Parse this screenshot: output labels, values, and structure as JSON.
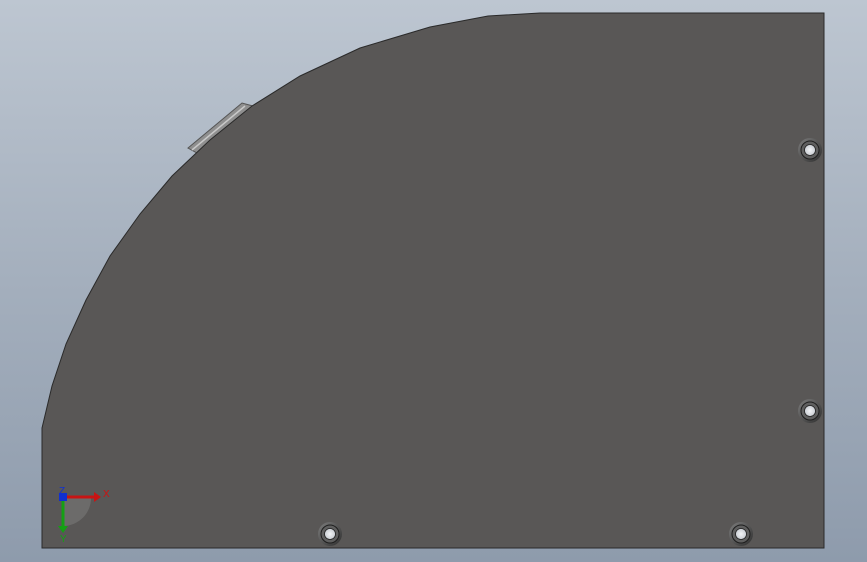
{
  "viewport": {
    "background_top": "#b9c3cf",
    "background_bottom": "#8d9bad",
    "part_face_color": "#595756",
    "part_edge_color": "#2a2a2a",
    "bevel_highlight": "#9a9a9a"
  },
  "part": {
    "name": "sheet-metal-plate",
    "hole_count": 4
  },
  "triad": {
    "x_label": "X",
    "y_label": "Y",
    "z_label": "Z",
    "x_color": "#d01010",
    "y_color": "#14a014",
    "z_color": "#1030d0"
  }
}
